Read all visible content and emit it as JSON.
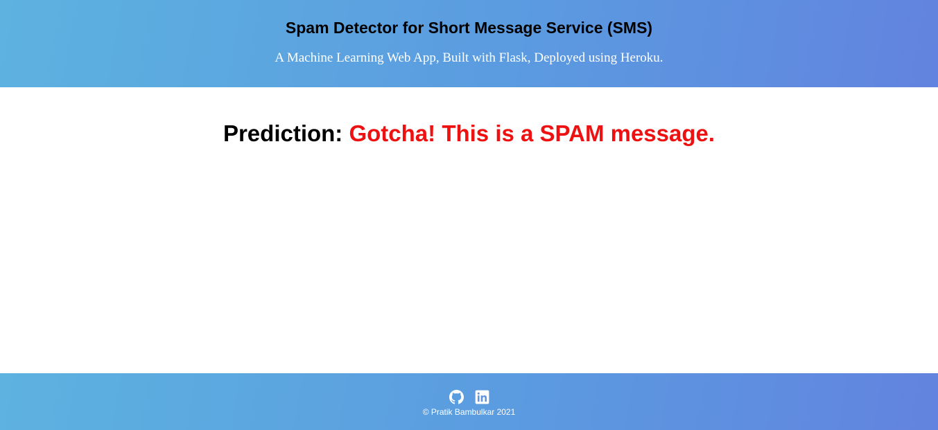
{
  "header": {
    "title": "Spam Detector for Short Message Service (SMS)",
    "subtitle": "A Machine Learning Web App, Built with Flask, Deployed using Heroku."
  },
  "main": {
    "prediction_label": "Prediction:",
    "prediction_result": "Gotcha! This is a SPAM message.",
    "result_color": "#ee1111"
  },
  "footer": {
    "social": [
      {
        "icon": "github-icon"
      },
      {
        "icon": "linkedin-icon"
      }
    ],
    "copyright": "© Pratik Bambulkar 2021"
  },
  "colors": {
    "gradient_start": "#5db2e0",
    "gradient_end": "#6283df"
  }
}
